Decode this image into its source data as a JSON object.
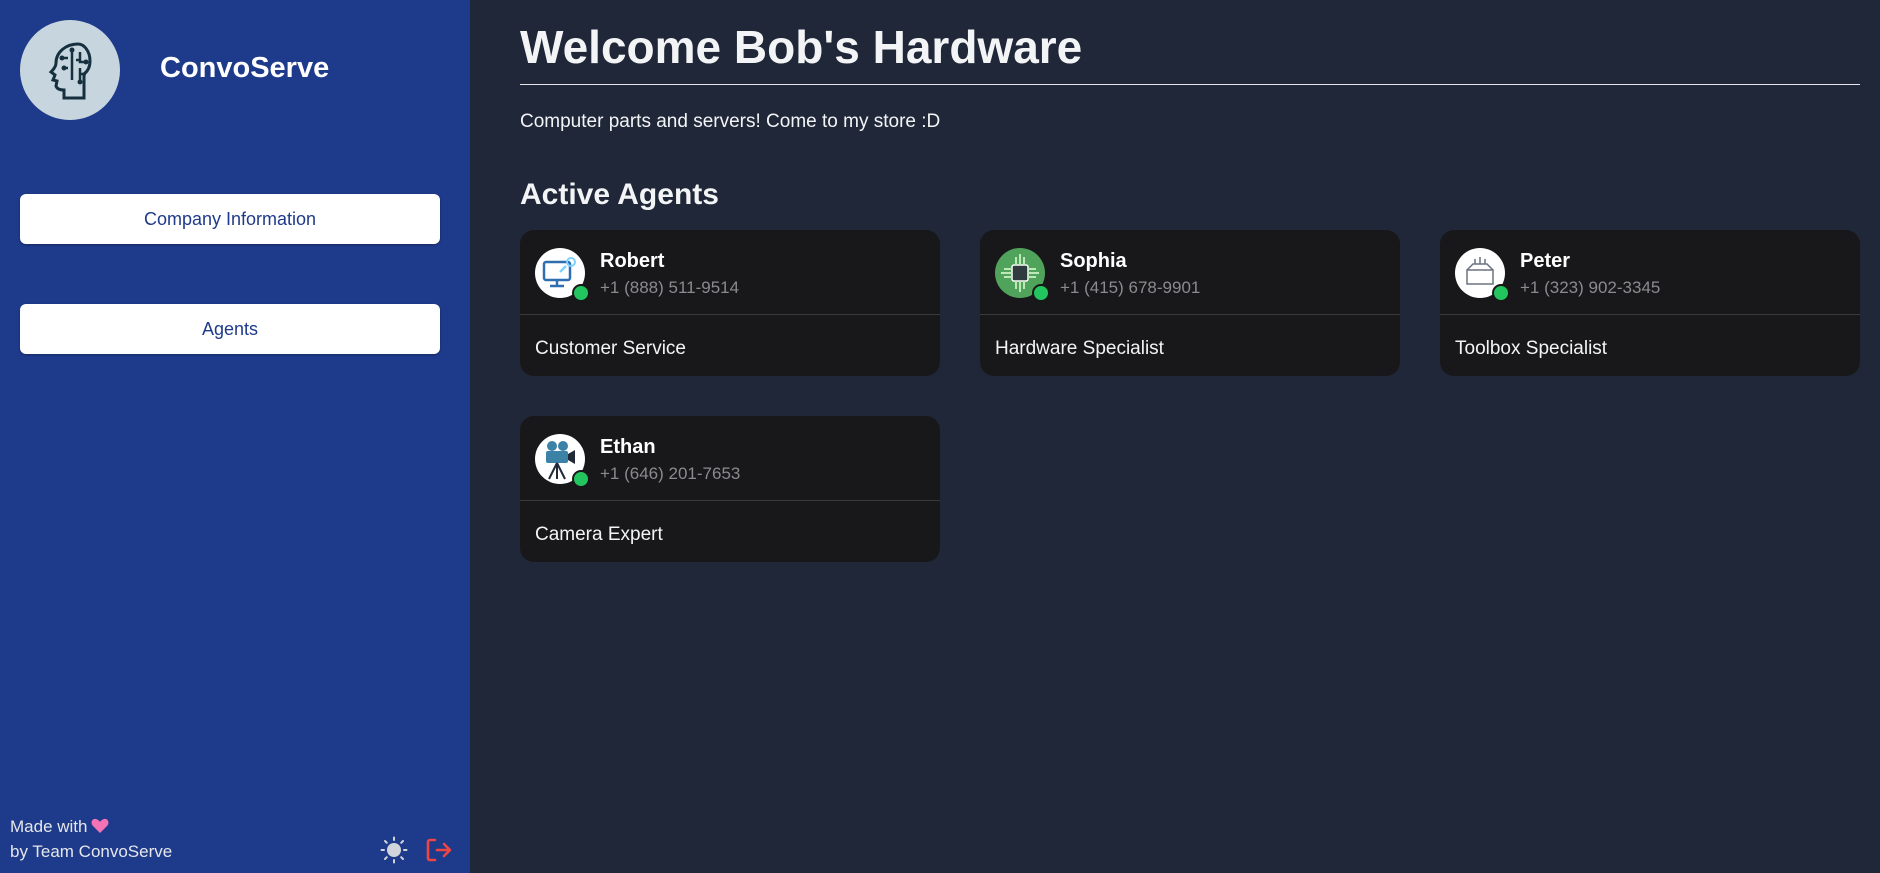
{
  "sidebar": {
    "brand": "ConvoServe",
    "nav": [
      {
        "label": "Company Information"
      },
      {
        "label": "Agents"
      }
    ],
    "footer": {
      "line1": "Made with",
      "line2": "by Team ConvoServe"
    },
    "icons": {
      "logo": "brain-circuit-icon",
      "heart": "heart-icon",
      "theme": "sun-icon",
      "logout": "logout-icon"
    }
  },
  "main": {
    "title": "Welcome Bob's Hardware",
    "subtitle": "Computer parts and servers! Come to my store :D",
    "section_title": "Active Agents",
    "agents": [
      {
        "name": "Robert",
        "phone": "+1 (888) 511-9514",
        "role": "Customer Service",
        "status": "online"
      },
      {
        "name": "Sophia",
        "phone": "+1 (415) 678-9901",
        "role": "Hardware Specialist",
        "status": "online"
      },
      {
        "name": "Peter",
        "phone": "+1 (323) 902-3345",
        "role": "Toolbox Specialist",
        "status": "online"
      },
      {
        "name": "Ethan",
        "phone": "+1 (646) 201-7653",
        "role": "Camera Expert",
        "status": "online"
      }
    ]
  },
  "colors": {
    "sidebar_bg": "#1e3a8a",
    "main_bg": "#1f2738",
    "card_bg": "#18181a",
    "online": "#22c55e",
    "logout": "#ef4444"
  }
}
